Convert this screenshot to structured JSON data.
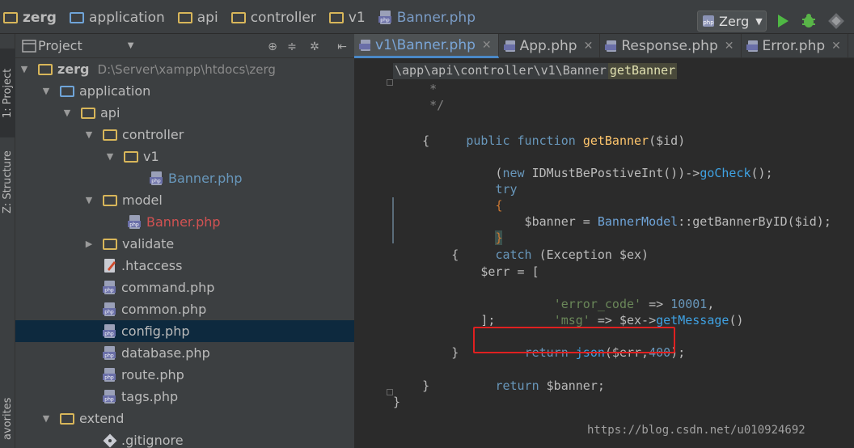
{
  "breadcrumbs": [
    {
      "label": "zerg",
      "type": "folder"
    },
    {
      "label": "application",
      "type": "folder-blue"
    },
    {
      "label": "api",
      "type": "folder"
    },
    {
      "label": "controller",
      "type": "folder"
    },
    {
      "label": "v1",
      "type": "folder"
    },
    {
      "label": "Banner.php",
      "type": "php"
    }
  ],
  "run_config": {
    "label": "Zerg"
  },
  "toolbar_icons": [
    "run-icon",
    "debug-icon",
    "coverage-icon"
  ],
  "side_stripe": {
    "project_label": "1: Project",
    "structure_label": "Z: Structure",
    "favorites_label": "avorites"
  },
  "project_panel": {
    "title": "Project",
    "tree": [
      {
        "label": "zerg",
        "path": "D:\\Server\\xampp\\htdocs\\zerg",
        "depth": 0,
        "kind": "folder",
        "expanded": true,
        "style": "bold"
      },
      {
        "label": "application",
        "depth": 1,
        "kind": "folder-blue",
        "expanded": true
      },
      {
        "label": "api",
        "depth": 2,
        "kind": "folder",
        "expanded": true
      },
      {
        "label": "controller",
        "depth": 3,
        "kind": "folder",
        "expanded": true
      },
      {
        "label": "v1",
        "depth": 4,
        "kind": "folder",
        "expanded": true
      },
      {
        "label": "Banner.php",
        "depth": 5,
        "kind": "php",
        "style": "blue"
      },
      {
        "label": "model",
        "depth": 3,
        "kind": "folder",
        "expanded": true
      },
      {
        "label": "Banner.php",
        "depth": 4,
        "kind": "php",
        "style": "red"
      },
      {
        "label": "validate",
        "depth": 3,
        "kind": "folder",
        "expanded": false
      },
      {
        "label": ".htaccess",
        "depth": 3,
        "kind": "file"
      },
      {
        "label": "command.php",
        "depth": 3,
        "kind": "php"
      },
      {
        "label": "common.php",
        "depth": 3,
        "kind": "php"
      },
      {
        "label": "config.php",
        "depth": 3,
        "kind": "php",
        "selected": true
      },
      {
        "label": "database.php",
        "depth": 3,
        "kind": "php"
      },
      {
        "label": "route.php",
        "depth": 3,
        "kind": "php"
      },
      {
        "label": "tags.php",
        "depth": 3,
        "kind": "php"
      },
      {
        "label": "extend",
        "depth": 1,
        "kind": "folder",
        "expanded": true
      },
      {
        "label": ".gitignore",
        "depth": 3,
        "kind": "git"
      }
    ]
  },
  "editor": {
    "tabs": [
      {
        "label": "v1\\Banner.php",
        "active": true
      },
      {
        "label": "App.php",
        "active": false
      },
      {
        "label": "Response.php",
        "active": false
      },
      {
        "label": "Error.php",
        "active": false
      }
    ],
    "path": "\\app\\api\\controller\\v1\\Banner",
    "method": "getBanner",
    "code_lines": [
      "     *",
      "     */",
      "    public function getBanner($id)",
      "    {",
      "        (new IDMustBePostiveInt())->goCheck();",
      "        try",
      "        {",
      "            $banner = BannerModel::getBannerByID($id);",
      "        }",
      "        catch (Exception $ex)",
      "        {",
      "            $err = [",
      "                'error_code' => 10001,",
      "                'msg' => $ex->getMessage()",
      "            ];",
      "            return json($err,400);",
      "        }",
      "        return $banner;",
      "    }",
      "}"
    ]
  },
  "watermark": "https://blog.csdn.net/u010924692",
  "colors": {
    "accent": "#4a88c7",
    "highlight_box": "#e02020",
    "selected_row": "#0d293e"
  }
}
